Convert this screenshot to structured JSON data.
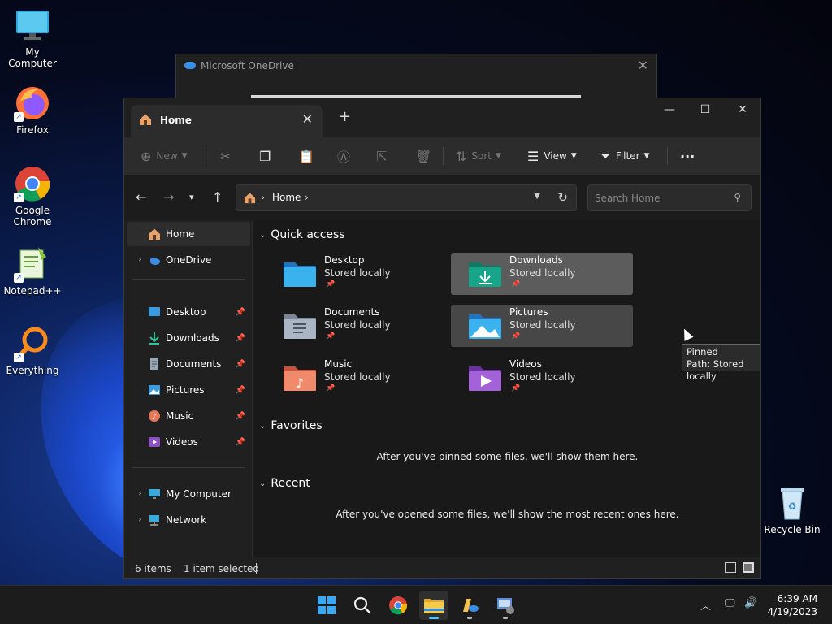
{
  "desktop": {
    "icons": [
      {
        "label": "My Computer"
      },
      {
        "label": "Firefox"
      },
      {
        "label": "Google Chrome"
      },
      {
        "label": "Notepad++"
      },
      {
        "label": "Everything"
      },
      {
        "label": "Recycle Bin"
      }
    ]
  },
  "onedrive_window": {
    "title": "Microsoft OneDrive"
  },
  "explorer": {
    "tab_label": "Home",
    "toolbar": {
      "new_label": "New",
      "sort_label": "Sort",
      "view_label": "View",
      "filter_label": "Filter",
      "more_label": "···"
    },
    "address": {
      "crumb": "Home"
    },
    "search": {
      "placeholder": "Search Home"
    },
    "sidebar": {
      "home": "Home",
      "onedrive": "OneDrive",
      "pinned": [
        {
          "label": "Desktop"
        },
        {
          "label": "Downloads"
        },
        {
          "label": "Documents"
        },
        {
          "label": "Pictures"
        },
        {
          "label": "Music"
        },
        {
          "label": "Videos"
        }
      ],
      "my_computer": "My Computer",
      "network": "Network"
    },
    "content": {
      "quick_access_heading": "Quick access",
      "tiles": [
        {
          "name": "Desktop",
          "sub": "Stored locally"
        },
        {
          "name": "Downloads",
          "sub": "Stored locally"
        },
        {
          "name": "Documents",
          "sub": "Stored locally"
        },
        {
          "name": "Pictures",
          "sub": "Stored locally"
        },
        {
          "name": "Music",
          "sub": "Stored locally"
        },
        {
          "name": "Videos",
          "sub": "Stored locally"
        }
      ],
      "tooltip_line1": "Pinned",
      "tooltip_line2": "Path: Stored locally",
      "favorites_heading": "Favorites",
      "favorites_empty": "After you've pinned some files, we'll show them here.",
      "recent_heading": "Recent",
      "recent_empty": "After you've opened some files, we'll show the most recent ones here."
    },
    "status": {
      "items": "6 items",
      "selected": "1 item selected"
    }
  },
  "taskbar": {
    "time": "6:39 AM",
    "date": "4/19/2023"
  },
  "colors": {
    "accent": "#4cc2ff",
    "folder_blue": "#3a9be0",
    "downloads_teal": "#17a589",
    "music_orange": "#e8775a",
    "videos_purple": "#8e4ec6"
  }
}
